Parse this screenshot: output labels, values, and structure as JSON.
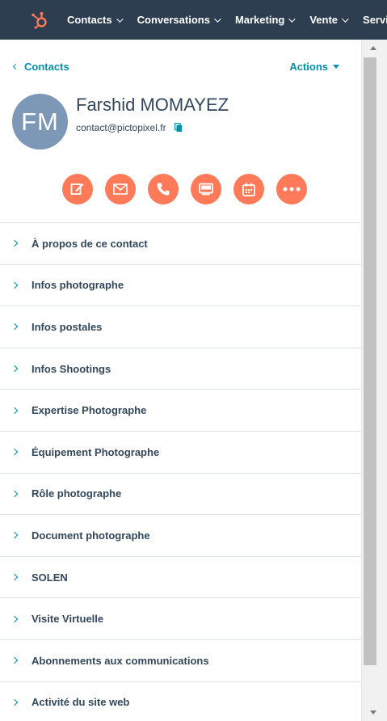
{
  "nav": {
    "items": [
      {
        "label": "Contacts"
      },
      {
        "label": "Conversations"
      },
      {
        "label": "Marketing"
      },
      {
        "label": "Vente"
      },
      {
        "label": "Service"
      }
    ],
    "brand_color": "#ff7a59",
    "bg_color": "#2d3e50"
  },
  "header": {
    "back_label": "Contacts",
    "actions_label": "Actions",
    "avatar_initials": "FM",
    "name": "Farshid MOMAYEZ",
    "email": "contact@pictopixel.fr"
  },
  "action_buttons": [
    {
      "icon": "edit-note-icon"
    },
    {
      "icon": "email-icon"
    },
    {
      "icon": "phone-icon"
    },
    {
      "icon": "log-activity-icon"
    },
    {
      "icon": "calendar-icon"
    },
    {
      "icon": "more-icon"
    }
  ],
  "sections": [
    {
      "label": "À propos de ce contact"
    },
    {
      "label": "Infos photographe"
    },
    {
      "label": "Infos postales"
    },
    {
      "label": "Infos Shootings"
    },
    {
      "label": "Expertise Photographe"
    },
    {
      "label": "Équipement Photographe"
    },
    {
      "label": "Rôle photographe"
    },
    {
      "label": "Document photographe"
    },
    {
      "label": "SOLEN"
    },
    {
      "label": "Visite Virtuelle"
    },
    {
      "label": "Abonnements aux communications"
    },
    {
      "label": "Activité du site web"
    }
  ],
  "colors": {
    "accent": "#0091ae",
    "action": "#ff7a59",
    "avatar": "#7c98b6"
  }
}
